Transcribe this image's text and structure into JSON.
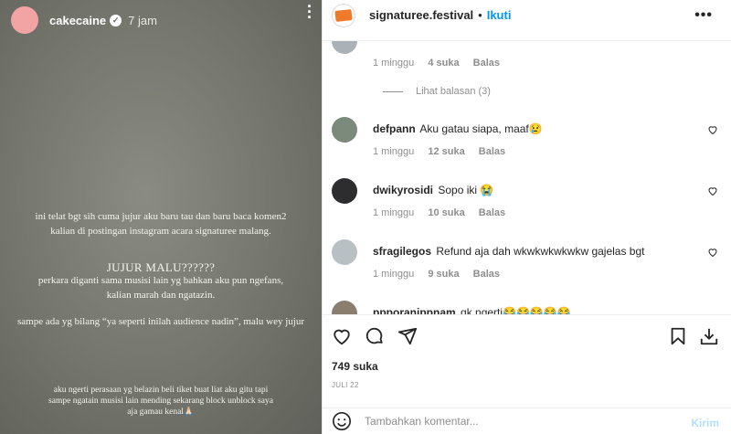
{
  "story": {
    "username": "cakecaine",
    "time": "7 jam",
    "text1": "ini telat bgt sih cuma jujur aku baru tau dan baru baca komen2 kalian di postingan instagram acara signaturee malang.",
    "text2": "JUJUR MALU??????",
    "text3": "perkara diganti sama musisi lain yg bahkan aku pun ngefans, kalian marah dan ngatazin.",
    "text4": "sampe ada yg bilang “ya seperti inilah audience nadin”, malu wey jujur",
    "text5": "aku ngerti perasaan yg belazin beli tiket buat liat aku gitu tapi sampe ngatain musisi lain mending sekarang block unblock saya aja gamau kenal🙏🏻"
  },
  "post": {
    "username": "signaturee.festival",
    "dot": "•",
    "follow_label": "Ikuti",
    "likes": "749 suka",
    "date": "JULI 22",
    "comment_placeholder": "Tambahkan komentar...",
    "post_label": "Kirim"
  },
  "comments": [
    {
      "time": "1 minggu",
      "likes": "4 suka",
      "reply_label": "Balas",
      "view_replies": "Lihat balasan (3)"
    },
    {
      "user": "defpann",
      "text": "Aku gatau siapa, maaf😢",
      "time": "1 minggu",
      "likes": "12 suka",
      "reply_label": "Balas"
    },
    {
      "user": "dwikyrosidi",
      "text": "Sopo iki 😭",
      "time": "1 minggu",
      "likes": "10 suka",
      "reply_label": "Balas"
    },
    {
      "user": "sfragilegos",
      "text": "Refund aja dah wkwkwkwkwkw gajelas bgt",
      "time": "1 minggu",
      "likes": "9 suka",
      "reply_label": "Balas"
    },
    {
      "user": "ppporanippnam",
      "text": "gk ngerti😂😂😂😂😂"
    }
  ],
  "colors": {
    "accent": "#0095f6",
    "post_button": "#b2dffc",
    "story_avatar": "#f2a3a3",
    "muted": "#8e8e8e"
  },
  "icons": [
    "verified-icon",
    "more-icon",
    "heart-icon",
    "comment-icon",
    "share-icon",
    "bookmark-icon",
    "download-icon",
    "emoji-icon"
  ]
}
